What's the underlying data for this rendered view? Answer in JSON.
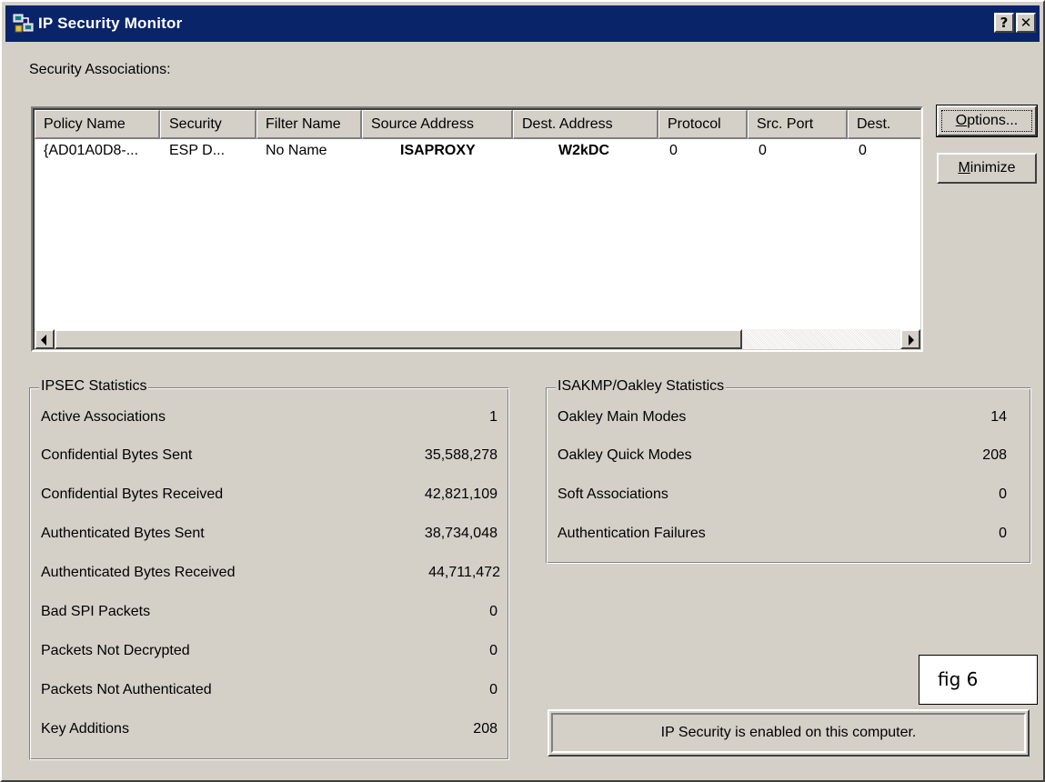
{
  "window": {
    "title": "IP Security Monitor",
    "help_button": "?",
    "close_button": "✕"
  },
  "security_associations": {
    "label": "Security Associations:",
    "columns": [
      "Policy Name",
      "Security",
      "Filter Name",
      "Source Address",
      "Dest. Address",
      "Protocol",
      "Src. Port",
      "Dest."
    ],
    "rows": [
      [
        "{AD01A0D8-...",
        "ESP D...",
        "No Name",
        "ISAPROXY",
        "W2kDC",
        "0",
        "0",
        "0"
      ]
    ]
  },
  "buttons": {
    "options": "Options...",
    "minimize": "Minimize"
  },
  "ipsec_statistics": {
    "title": "IPSEC Statistics",
    "rows": [
      {
        "label": "Active Associations",
        "value": "1"
      },
      {
        "label": "Confidential Bytes Sent",
        "value": "35,588,278"
      },
      {
        "label": "Confidential Bytes Received",
        "value": "42,821,109"
      },
      {
        "label": "Authenticated Bytes Sent",
        "value": "38,734,048"
      },
      {
        "label": "Authenticated Bytes Received",
        "value": "44,711,472"
      },
      {
        "label": "Bad SPI Packets",
        "value": "0"
      },
      {
        "label": "Packets Not Decrypted",
        "value": "0"
      },
      {
        "label": "Packets Not Authenticated",
        "value": "0"
      },
      {
        "label": "Key Additions",
        "value": "208"
      }
    ]
  },
  "isakmp_statistics": {
    "title": "ISAKMP/Oakley Statistics",
    "rows": [
      {
        "label": "Oakley Main Modes",
        "value": "14"
      },
      {
        "label": "Oakley Quick Modes",
        "value": "208"
      },
      {
        "label": "Soft Associations",
        "value": "0"
      },
      {
        "label": "Authentication Failures",
        "value": "0"
      }
    ]
  },
  "status": {
    "text": "IP Security is enabled on this computer."
  },
  "annotation": {
    "text": "fig 6"
  },
  "colors": {
    "titlebar": "#0a246a",
    "face": "#d4d0c8"
  }
}
